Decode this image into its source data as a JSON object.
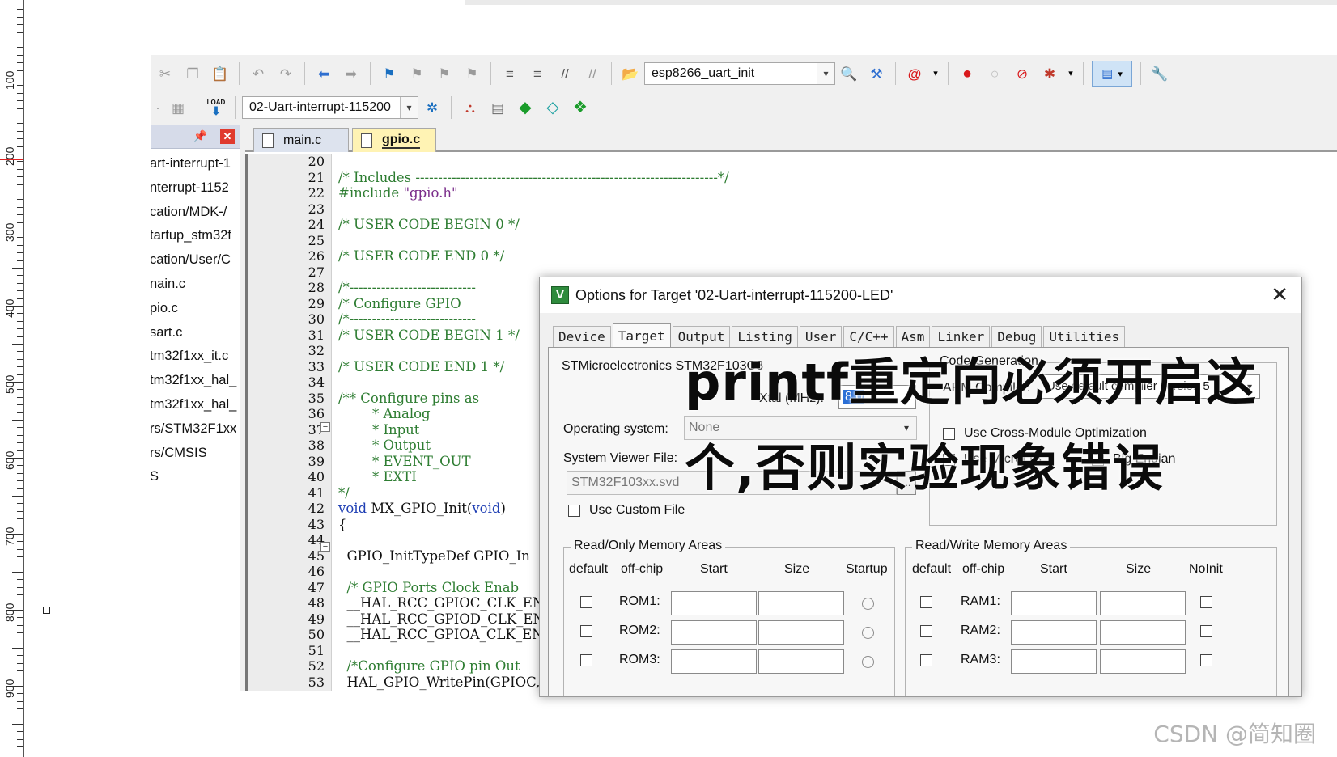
{
  "ruler": {
    "labels": [
      "100",
      "200",
      "300",
      "400",
      "500",
      "600",
      "700",
      "800",
      "900"
    ]
  },
  "toolbar": {
    "function_combo": "esp8266_uart_init",
    "target_combo": "02-Uart-interrupt-115200",
    "load_label": "LOAD",
    "colors": {
      "red_dot": "#d9191c",
      "green": "#1a9c2a",
      "blue_arrow": "#2f6fd0"
    }
  },
  "project": {
    "items": [
      "art-interrupt-1",
      "nterrupt-1152",
      "cation/MDK-/",
      "tartup_stm32f",
      "cation/User/C",
      "nain.c",
      "pio.c",
      "sart.c",
      "tm32f1xx_it.c",
      "tm32f1xx_hal_",
      "tm32f1xx_hal_",
      "rs/STM32F1xx",
      "rs/CMSIS",
      "S"
    ]
  },
  "editor": {
    "tabs": [
      {
        "label": "main.c"
      },
      {
        "label": "gpio.c"
      }
    ],
    "line_numbers": [
      "20",
      "21",
      "22",
      "23",
      "24",
      "25",
      "26",
      "27",
      "28",
      "29",
      "30",
      "31",
      "32",
      "33",
      "34",
      "35",
      "36",
      "37",
      "38",
      "39",
      "40",
      "41",
      "42",
      "43",
      "44",
      "45",
      "46",
      "47",
      "48",
      "49",
      "50",
      "51",
      "52",
      "53"
    ],
    "lines": {
      "l21": "/* Includes -------------------------------------------------------------------*/",
      "l22a": "#include ",
      "l22b": "\"gpio.h\"",
      "l24": "/* USER CODE BEGIN 0 */",
      "l26": "/* USER CODE END 0 */",
      "l28": "/*----------------------------",
      "l29": "/* Configure GPIO",
      "l30": "/*----------------------------",
      "l31": "/* USER CODE BEGIN 1 */",
      "l33": "/* USER CODE END 1 */",
      "l35": "/** Configure pins as",
      "l36": "        * Analog",
      "l37": "        * Input",
      "l38": "        * Output",
      "l39": "        * EVENT_OUT",
      "l40": "        * EXTI",
      "l41": "*/",
      "l42a": "void",
      "l42b": " MX_GPIO_Init(",
      "l42c": "void",
      "l42d": ")",
      "l43": "{",
      "l45": "  GPIO_InitTypeDef GPIO_In",
      "l47": "  /* GPIO Ports Clock Enab",
      "l48": "  __HAL_RCC_GPIOC_CLK_ENAB",
      "l49": "  __HAL_RCC_GPIOD_CLK_ENAB",
      "l50": "  __HAL_RCC_GPIOA_CLK_ENAB",
      "l52": "  /*Configure GPIO pin Out",
      "l53": "  HAL_GPIO_WritePin(GPIOC,"
    }
  },
  "dialog": {
    "title": "Options for Target '02-Uart-interrupt-115200-LED'",
    "tabs": [
      "Device",
      "Target",
      "Output",
      "Listing",
      "User",
      "C/C++",
      "Asm",
      "Linker",
      "Debug",
      "Utilities"
    ],
    "device_name": "STMicroelectronics STM32F103C8",
    "xtal_label": "Xtal (MHz):",
    "xtal_value": "8.0",
    "os_label": "Operating system:",
    "os_value": "None",
    "svd_label": "System Viewer File:",
    "svd_value": "STM32F103xx.svd",
    "svd_button": "...",
    "use_custom_file": "Use Custom File",
    "code_generation": "Code Generation",
    "arm_compiler_label": "ARM Compiler:",
    "arm_compiler_value": "Use default compiler version 5",
    "cross_module": "Use Cross-Module Optimization",
    "use_microlib": "Use MicroLIB",
    "big_endian": "Big Endian",
    "rom_group": {
      "title": "Read/Only Memory Areas",
      "headers": [
        "default",
        "off-chip",
        "Start",
        "Size",
        "Startup"
      ],
      "rows": [
        "ROM1:",
        "ROM2:",
        "ROM3:"
      ]
    },
    "ram_group": {
      "title": "Read/Write Memory Areas",
      "headers": [
        "default",
        "off-chip",
        "Start",
        "Size",
        "NoInit"
      ],
      "rows": [
        "RAM1:",
        "RAM2:",
        "RAM3:"
      ]
    }
  },
  "overlay": {
    "line1": "printf重定向必须开启这",
    "line2": "个,否则实验现象错误"
  },
  "watermark": "CSDN @简知圈"
}
